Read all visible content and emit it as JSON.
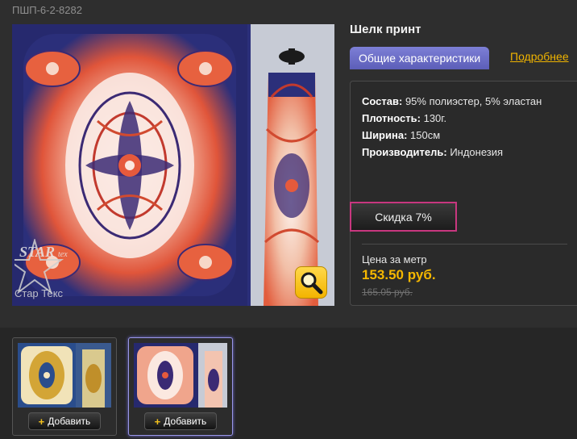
{
  "product": {
    "sku": "ПШП-6-2-8282",
    "title": "Шелк принт",
    "watermark_text": "Стар Текс",
    "watermark_logo_text": "STAR tex"
  },
  "tabs": {
    "general": "Общие характеристики",
    "more": "Подробнее"
  },
  "specs": [
    {
      "label": "Состав:",
      "value": "95% полиэстер, 5% эластан"
    },
    {
      "label": "Плотность:",
      "value": "130г."
    },
    {
      "label": "Ширина:",
      "value": "150см"
    },
    {
      "label": "Производитель:",
      "value": "Индонезия"
    }
  ],
  "discount": "Скидка 7%",
  "pricing": {
    "label": "Цена за метр",
    "price": "153.50 руб.",
    "old_price": "165.05 руб."
  },
  "thumbnails": [
    {
      "add_label": "Добавить",
      "selected": false
    },
    {
      "add_label": "Добавить",
      "selected": true
    }
  ],
  "colors": {
    "accent_tab": "#6f71cc",
    "price": "#f5b700",
    "discount_border": "#c8377f",
    "link": "#f0b400"
  },
  "icons": {
    "zoom": "magnifier-icon",
    "add": "plus-icon"
  }
}
